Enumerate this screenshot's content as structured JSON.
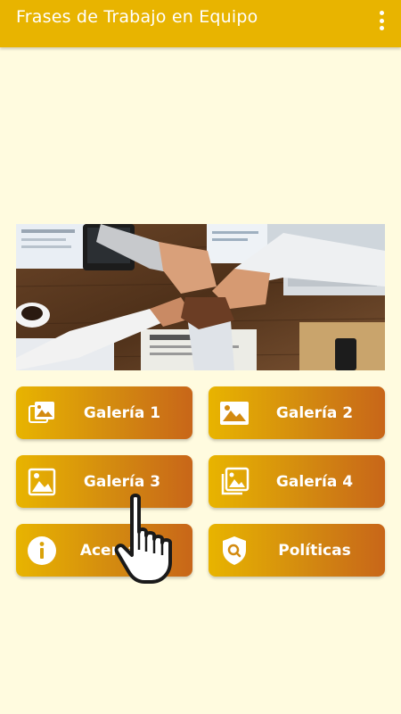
{
  "app": {
    "title": "Frases de Trabajo en Equipo"
  },
  "icons": {
    "menu": "more-vert-icon",
    "gallery": "image-icon",
    "info": "info-icon",
    "policy": "shield-search-icon",
    "cursor": "hand-pointer-icon"
  },
  "colors": {
    "appbar": "#e8b400",
    "background": "#fffbdf",
    "button_gradient_start": "#e8b400",
    "button_gradient_end": "#c86619",
    "text": "#ffffff"
  },
  "buttons": [
    {
      "label": "Galería 1",
      "icon": "images-stack-icon"
    },
    {
      "label": "Galería 2",
      "icon": "image-icon"
    },
    {
      "label": "Galería 3",
      "icon": "image-frame-icon"
    },
    {
      "label": "Galería 4",
      "icon": "images-stack-frame-icon"
    },
    {
      "label": "Acerca de",
      "icon": "info-icon"
    },
    {
      "label": "Políticas",
      "icon": "shield-search-icon"
    }
  ]
}
